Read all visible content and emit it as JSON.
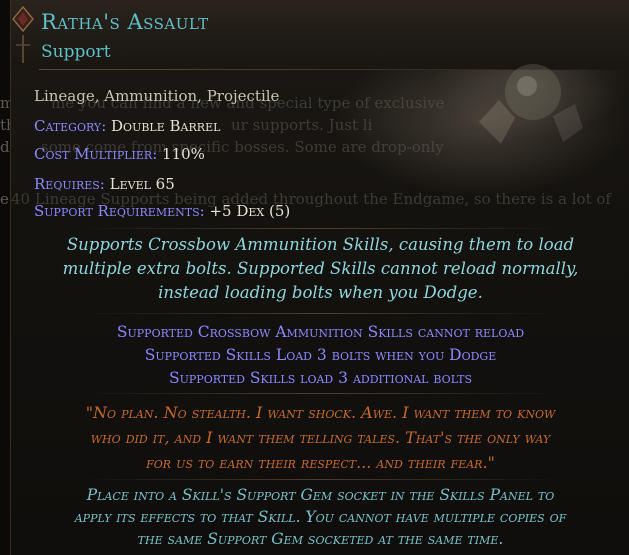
{
  "background_fragments": [
    {
      "text": "me"
    },
    {
      "text": "th"
    },
    {
      "text": "d"
    },
    {
      "text": "e"
    },
    {
      "text": "me you can find a new and special type of exclusive"
    },
    {
      "text": "ur supports. Just li"
    },
    {
      "text": "some come from specific bosses. Some are drop-only"
    },
    {
      "text": "40 Lineage Supports being added throughout the Endgame, so there is a lot of"
    }
  ],
  "item": {
    "name": "Ratha's Assault",
    "type": "Support",
    "tags": "Lineage, Ammunition, Projectile",
    "properties": [
      {
        "key": "Category: ",
        "value": "Double Barrel"
      },
      {
        "key": "Cost Multiplier: ",
        "value": "110%"
      }
    ],
    "requires": {
      "key": "Requires: ",
      "value": "Level 65"
    },
    "support_requirements": {
      "key": "Support Requirements: ",
      "value": "+5 Dex (5)"
    },
    "description": [
      "Supports Crossbow Ammunition Skills, causing them to load",
      "multiple extra bolts. Supported Skills cannot reload normally,",
      "instead loading bolts when you Dodge."
    ],
    "modifiers": [
      "Supported Crossbow Ammunition Skills cannot reload",
      "Supported Skills Load 3 bolts when you Dodge",
      "Supported Skills load 3 additional bolts"
    ],
    "flavour": [
      "\"No plan. No stealth. I want shock. Awe. I want them to know",
      "who did it, and I want them telling tales. That's the only way",
      "for us to earn their respect... and their fear.\""
    ],
    "help": [
      "Place into a Skill's Support Gem socket in the Skills Panel to",
      "apply its effects to that Skill. You cannot have multiple copies of",
      "the same Support Gem socketed at the same time."
    ]
  },
  "colors": {
    "name": "#5fc0c8",
    "label": "#8c8afd",
    "value": "#e6e2d6",
    "description": "#8fd6dc",
    "modifier": "#8c8afd",
    "flavour": "#c56a2e",
    "help": "#77c1c9"
  }
}
